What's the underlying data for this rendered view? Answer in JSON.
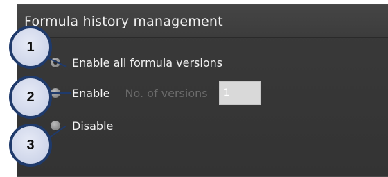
{
  "panel": {
    "title": "Formula history management"
  },
  "options": [
    {
      "label": "Enable all formula versions",
      "selected": true
    },
    {
      "label": "Enable",
      "selected": false
    },
    {
      "label": "Disable",
      "selected": false
    }
  ],
  "versions": {
    "label": "No. of versions",
    "value": "1"
  },
  "callouts": [
    "1",
    "2",
    "3"
  ],
  "colors": {
    "panel_bg": "#363636",
    "callout_border": "#1f3a6b",
    "callout_fill": "#d6dced"
  }
}
